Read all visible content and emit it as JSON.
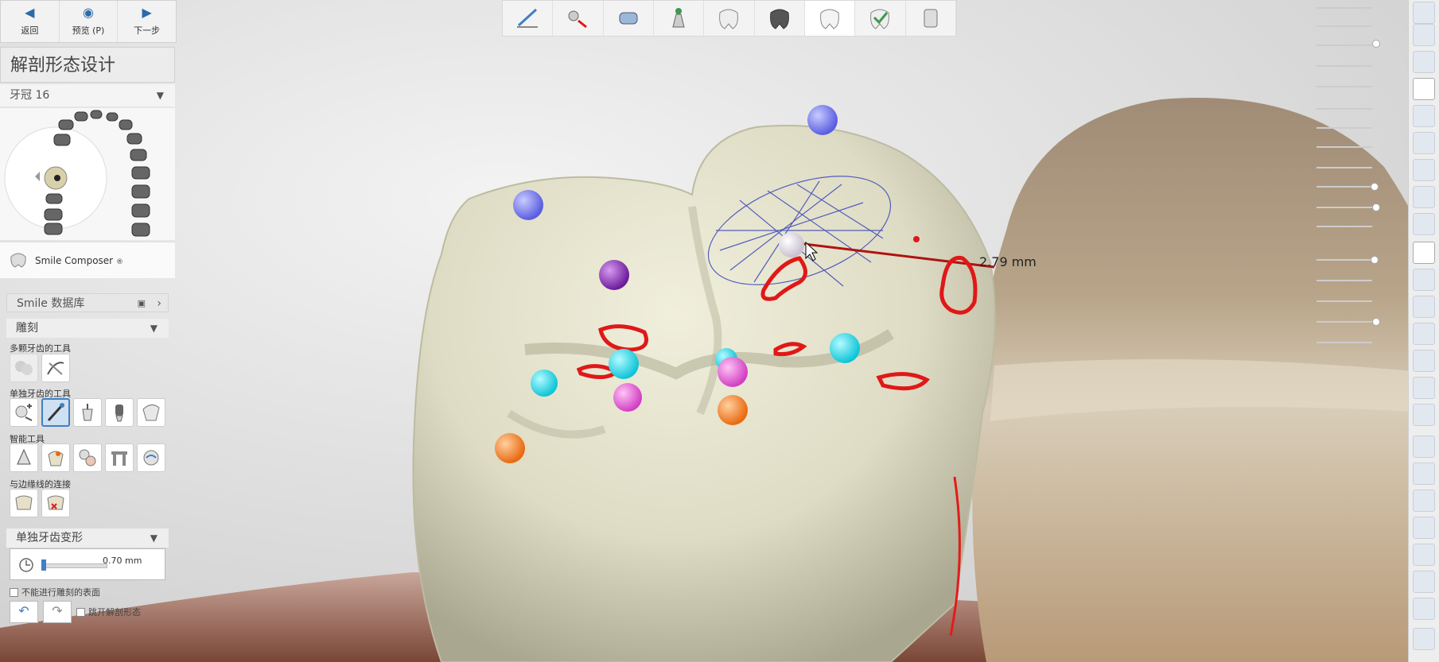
{
  "nav": {
    "back_label": "返回",
    "preview_label": "预览 (P)",
    "next_label": "下一步"
  },
  "panel": {
    "title": "解剖形态设计",
    "crown_selector": "牙冠 16",
    "smile_composer": "Smile Composer",
    "smile_composer_mark": "®",
    "smile_library": "Smile 数据库",
    "carve_section": "雕刻",
    "multi_tooth_tools": "多颗牙齿的工具",
    "single_tooth_tools": "单独牙齿的工具",
    "smart_tools": "智能工具",
    "margin_connect": "与边缘线的连接",
    "deform_section": "单独牙齿变形",
    "deform_value": "0.70 mm",
    "no_intersect_label": "不能进行雕刻的表面",
    "keep_anatomy_label": "跳开解剖形态"
  },
  "viewport": {
    "measurement": "2.79 mm"
  },
  "colors": {
    "accent": "#3f7fc4",
    "tooth": "#e6e6d0",
    "contour_red": "#e01818"
  }
}
